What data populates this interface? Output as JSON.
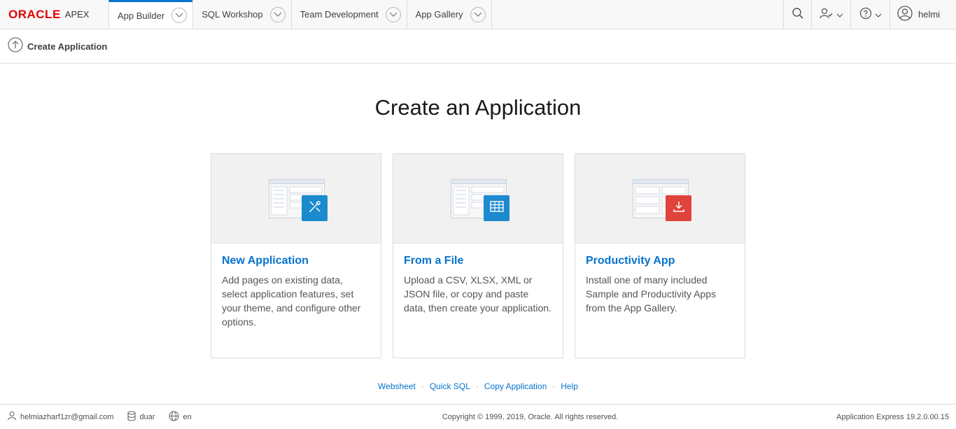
{
  "header": {
    "logo_brand": "ORACLE",
    "logo_product": "APEX",
    "tabs": [
      {
        "label": "App Builder",
        "active": true
      },
      {
        "label": "SQL Workshop",
        "active": false
      },
      {
        "label": "Team Development",
        "active": false
      },
      {
        "label": "App Gallery",
        "active": false
      }
    ],
    "user_name": "helmi",
    "icons": {
      "search": "search-icon",
      "people": "people-icon",
      "help": "help-icon",
      "user": "user-avatar-icon"
    }
  },
  "breadcrumb": {
    "label": "Create Application",
    "icon": "up-arrow-icon"
  },
  "main": {
    "title": "Create an Application",
    "cards": [
      {
        "title": "New Application",
        "description": "Add pages on existing data, select application features, set your theme, and configure other options.",
        "badge_icon": "tools-icon",
        "badge_color": "#1c8acf"
      },
      {
        "title": "From a File",
        "description": "Upload a CSV, XLSX, XML or JSON file, or copy and paste data, then create your application.",
        "badge_icon": "table-icon",
        "badge_color": "#1c8acf"
      },
      {
        "title": "Productivity App",
        "description": "Install one of many included Sample and Productivity Apps from the App Gallery.",
        "badge_icon": "download-icon",
        "badge_color": "#e0433b"
      }
    ]
  },
  "links": {
    "websheet": "Websheet",
    "quick_sql": "Quick SQL",
    "copy_application": "Copy Application",
    "help": "Help",
    "separator": "·"
  },
  "footer": {
    "email": "helmiazharf1zr@gmail.com",
    "workspace": "duar",
    "language": "en",
    "copyright": "Copyright © 1999, 2019, Oracle. All rights reserved.",
    "version": "Application Express 19.2.0.00.15"
  },
  "colors": {
    "accent": "#0572ce",
    "brand": "#e30000"
  }
}
